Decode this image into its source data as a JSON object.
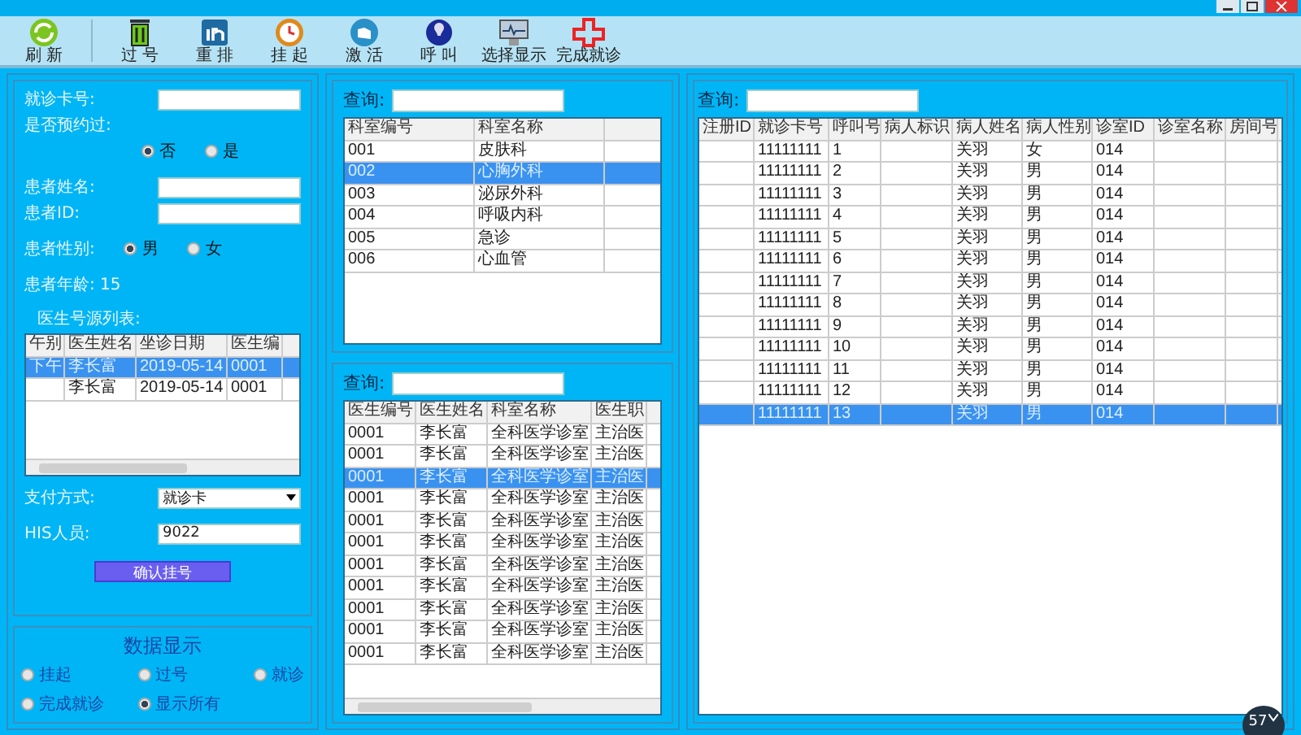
{
  "toolbar": [
    {
      "label": "刷 新"
    },
    {
      "label": "过 号"
    },
    {
      "label": "重 排"
    },
    {
      "label": "挂 起"
    },
    {
      "label": "激 活"
    },
    {
      "label": "呼 叫"
    },
    {
      "label": "选择显示"
    },
    {
      "label": "完成就诊"
    }
  ],
  "registration": {
    "card_label": "就诊卡号:",
    "appointment": {
      "label": "是否预约过:",
      "options": [
        {
          "label": "否",
          "selected": true
        },
        {
          "label": "是",
          "selected": false
        }
      ]
    },
    "name_label": "患者姓名:",
    "id_label": "患者ID:",
    "gender": {
      "label": "患者性别:",
      "options": [
        {
          "label": "男",
          "selected": true
        },
        {
          "label": "女",
          "selected": false
        }
      ]
    },
    "age": "患者年龄: 15",
    "schedule_title": "医生号源列表:",
    "schedule": {
      "columns": [
        "午别",
        "医生姓名",
        "坐诊日期",
        "医生编"
      ],
      "rows": [
        {
          "cells": [
            "下午",
            "李长富",
            "2019-05-14",
            "0001"
          ],
          "selected": true
        },
        {
          "cells": [
            "",
            "李长富",
            "2019-05-14",
            "0001"
          ],
          "selected": false
        }
      ]
    },
    "payment_label": "支付方式:",
    "payment_value": "就诊卡",
    "his_label": "HIS人员:",
    "his_value": "9022",
    "confirm": "确认挂号"
  },
  "display": {
    "title": "数据显示",
    "options": [
      {
        "label": "挂起",
        "selected": false
      },
      {
        "label": "过号",
        "selected": false
      },
      {
        "label": "就诊",
        "selected": false
      },
      {
        "label": "完成就诊",
        "selected": false
      },
      {
        "label": "显示所有",
        "selected": true
      }
    ]
  },
  "departments": {
    "search_label": "查询:",
    "columns": [
      "科室编号",
      "科室名称"
    ],
    "rows": [
      {
        "cells": [
          "001",
          "皮肤科"
        ],
        "selected": false
      },
      {
        "cells": [
          "002",
          "心胸外科"
        ],
        "selected": true
      },
      {
        "cells": [
          "003",
          "泌尿外科"
        ],
        "selected": false
      },
      {
        "cells": [
          "004",
          "呼吸内科"
        ],
        "selected": false
      },
      {
        "cells": [
          "005",
          "急诊"
        ],
        "selected": false
      },
      {
        "cells": [
          "006",
          "心血管"
        ],
        "selected": false
      }
    ]
  },
  "doctors": {
    "search_label": "查询:",
    "columns": [
      "医生编号",
      "医生姓名",
      "科室名称",
      "医生职"
    ],
    "rows": [
      {
        "cells": [
          "0001",
          "李长富",
          "全科医学诊室",
          "主治医"
        ],
        "selected": false
      },
      {
        "cells": [
          "0001",
          "李长富",
          "全科医学诊室",
          "主治医"
        ],
        "selected": false
      },
      {
        "cells": [
          "0001",
          "李长富",
          "全科医学诊室",
          "主治医"
        ],
        "selected": true
      },
      {
        "cells": [
          "0001",
          "李长富",
          "全科医学诊室",
          "主治医"
        ],
        "selected": false
      },
      {
        "cells": [
          "0001",
          "李长富",
          "全科医学诊室",
          "主治医"
        ],
        "selected": false
      },
      {
        "cells": [
          "0001",
          "李长富",
          "全科医学诊室",
          "主治医"
        ],
        "selected": false
      },
      {
        "cells": [
          "0001",
          "李长富",
          "全科医学诊室",
          "主治医"
        ],
        "selected": false
      },
      {
        "cells": [
          "0001",
          "李长富",
          "全科医学诊室",
          "主治医"
        ],
        "selected": false
      },
      {
        "cells": [
          "0001",
          "李长富",
          "全科医学诊室",
          "主治医"
        ],
        "selected": false
      },
      {
        "cells": [
          "0001",
          "李长富",
          "全科医学诊室",
          "主治医"
        ],
        "selected": false
      },
      {
        "cells": [
          "0001",
          "李长富",
          "全科医学诊室",
          "主治医"
        ],
        "selected": false
      }
    ]
  },
  "queue": {
    "search_label": "查询:",
    "columns": [
      "注册ID",
      "就诊卡号",
      "呼叫号",
      "病人标识",
      "病人姓名",
      "病人性别",
      "诊室ID",
      "诊室名称",
      "房间号"
    ],
    "rows": [
      {
        "cells": [
          "",
          "11111111",
          "1",
          "",
          "关羽",
          "女",
          "014",
          "",
          ""
        ],
        "selected": false
      },
      {
        "cells": [
          "",
          "11111111",
          "2",
          "",
          "关羽",
          "男",
          "014",
          "",
          ""
        ],
        "selected": false
      },
      {
        "cells": [
          "",
          "11111111",
          "3",
          "",
          "关羽",
          "男",
          "014",
          "",
          ""
        ],
        "selected": false
      },
      {
        "cells": [
          "",
          "11111111",
          "4",
          "",
          "关羽",
          "男",
          "014",
          "",
          ""
        ],
        "selected": false
      },
      {
        "cells": [
          "",
          "11111111",
          "5",
          "",
          "关羽",
          "男",
          "014",
          "",
          ""
        ],
        "selected": false
      },
      {
        "cells": [
          "",
          "11111111",
          "6",
          "",
          "关羽",
          "男",
          "014",
          "",
          ""
        ],
        "selected": false
      },
      {
        "cells": [
          "",
          "11111111",
          "7",
          "",
          "关羽",
          "男",
          "014",
          "",
          ""
        ],
        "selected": false
      },
      {
        "cells": [
          "",
          "11111111",
          "8",
          "",
          "关羽",
          "男",
          "014",
          "",
          ""
        ],
        "selected": false
      },
      {
        "cells": [
          "",
          "11111111",
          "9",
          "",
          "关羽",
          "男",
          "014",
          "",
          ""
        ],
        "selected": false
      },
      {
        "cells": [
          "",
          "11111111",
          "10",
          "",
          "关羽",
          "男",
          "014",
          "",
          ""
        ],
        "selected": false
      },
      {
        "cells": [
          "",
          "11111111",
          "11",
          "",
          "关羽",
          "男",
          "014",
          "",
          ""
        ],
        "selected": false
      },
      {
        "cells": [
          "",
          "11111111",
          "12",
          "",
          "关羽",
          "男",
          "014",
          "",
          ""
        ],
        "selected": false
      },
      {
        "cells": [
          "",
          "11111111",
          "13",
          "",
          "关羽",
          "男",
          "014",
          "",
          ""
        ],
        "selected": true
      }
    ]
  },
  "badge": "57"
}
